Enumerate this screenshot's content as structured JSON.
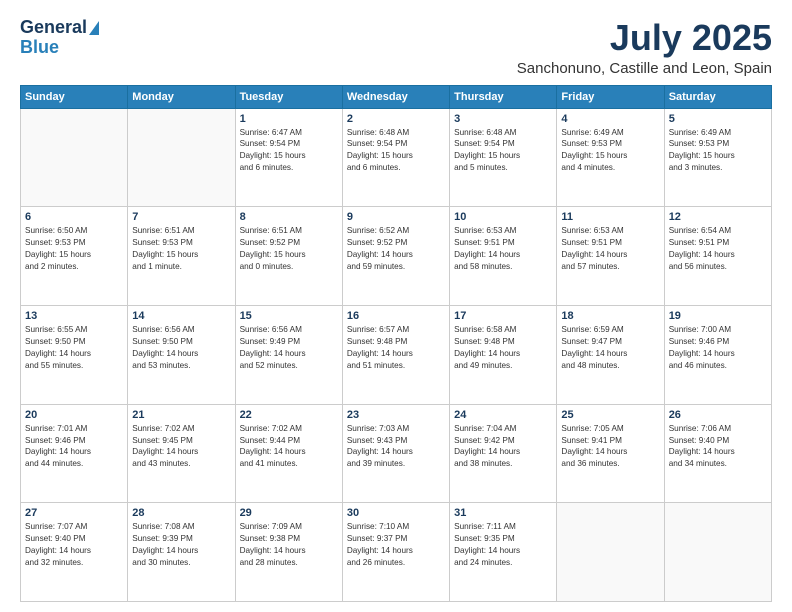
{
  "header": {
    "logo_line1": "General",
    "logo_line2": "Blue",
    "main_title": "July 2025",
    "subtitle": "Sanchonuno, Castille and Leon, Spain"
  },
  "calendar": {
    "headers": [
      "Sunday",
      "Monday",
      "Tuesday",
      "Wednesday",
      "Thursday",
      "Friday",
      "Saturday"
    ],
    "rows": [
      [
        {
          "day": "",
          "info": ""
        },
        {
          "day": "",
          "info": ""
        },
        {
          "day": "1",
          "info": "Sunrise: 6:47 AM\nSunset: 9:54 PM\nDaylight: 15 hours\nand 6 minutes."
        },
        {
          "day": "2",
          "info": "Sunrise: 6:48 AM\nSunset: 9:54 PM\nDaylight: 15 hours\nand 6 minutes."
        },
        {
          "day": "3",
          "info": "Sunrise: 6:48 AM\nSunset: 9:54 PM\nDaylight: 15 hours\nand 5 minutes."
        },
        {
          "day": "4",
          "info": "Sunrise: 6:49 AM\nSunset: 9:53 PM\nDaylight: 15 hours\nand 4 minutes."
        },
        {
          "day": "5",
          "info": "Sunrise: 6:49 AM\nSunset: 9:53 PM\nDaylight: 15 hours\nand 3 minutes."
        }
      ],
      [
        {
          "day": "6",
          "info": "Sunrise: 6:50 AM\nSunset: 9:53 PM\nDaylight: 15 hours\nand 2 minutes."
        },
        {
          "day": "7",
          "info": "Sunrise: 6:51 AM\nSunset: 9:53 PM\nDaylight: 15 hours\nand 1 minute."
        },
        {
          "day": "8",
          "info": "Sunrise: 6:51 AM\nSunset: 9:52 PM\nDaylight: 15 hours\nand 0 minutes."
        },
        {
          "day": "9",
          "info": "Sunrise: 6:52 AM\nSunset: 9:52 PM\nDaylight: 14 hours\nand 59 minutes."
        },
        {
          "day": "10",
          "info": "Sunrise: 6:53 AM\nSunset: 9:51 PM\nDaylight: 14 hours\nand 58 minutes."
        },
        {
          "day": "11",
          "info": "Sunrise: 6:53 AM\nSunset: 9:51 PM\nDaylight: 14 hours\nand 57 minutes."
        },
        {
          "day": "12",
          "info": "Sunrise: 6:54 AM\nSunset: 9:51 PM\nDaylight: 14 hours\nand 56 minutes."
        }
      ],
      [
        {
          "day": "13",
          "info": "Sunrise: 6:55 AM\nSunset: 9:50 PM\nDaylight: 14 hours\nand 55 minutes."
        },
        {
          "day": "14",
          "info": "Sunrise: 6:56 AM\nSunset: 9:50 PM\nDaylight: 14 hours\nand 53 minutes."
        },
        {
          "day": "15",
          "info": "Sunrise: 6:56 AM\nSunset: 9:49 PM\nDaylight: 14 hours\nand 52 minutes."
        },
        {
          "day": "16",
          "info": "Sunrise: 6:57 AM\nSunset: 9:48 PM\nDaylight: 14 hours\nand 51 minutes."
        },
        {
          "day": "17",
          "info": "Sunrise: 6:58 AM\nSunset: 9:48 PM\nDaylight: 14 hours\nand 49 minutes."
        },
        {
          "day": "18",
          "info": "Sunrise: 6:59 AM\nSunset: 9:47 PM\nDaylight: 14 hours\nand 48 minutes."
        },
        {
          "day": "19",
          "info": "Sunrise: 7:00 AM\nSunset: 9:46 PM\nDaylight: 14 hours\nand 46 minutes."
        }
      ],
      [
        {
          "day": "20",
          "info": "Sunrise: 7:01 AM\nSunset: 9:46 PM\nDaylight: 14 hours\nand 44 minutes."
        },
        {
          "day": "21",
          "info": "Sunrise: 7:02 AM\nSunset: 9:45 PM\nDaylight: 14 hours\nand 43 minutes."
        },
        {
          "day": "22",
          "info": "Sunrise: 7:02 AM\nSunset: 9:44 PM\nDaylight: 14 hours\nand 41 minutes."
        },
        {
          "day": "23",
          "info": "Sunrise: 7:03 AM\nSunset: 9:43 PM\nDaylight: 14 hours\nand 39 minutes."
        },
        {
          "day": "24",
          "info": "Sunrise: 7:04 AM\nSunset: 9:42 PM\nDaylight: 14 hours\nand 38 minutes."
        },
        {
          "day": "25",
          "info": "Sunrise: 7:05 AM\nSunset: 9:41 PM\nDaylight: 14 hours\nand 36 minutes."
        },
        {
          "day": "26",
          "info": "Sunrise: 7:06 AM\nSunset: 9:40 PM\nDaylight: 14 hours\nand 34 minutes."
        }
      ],
      [
        {
          "day": "27",
          "info": "Sunrise: 7:07 AM\nSunset: 9:40 PM\nDaylight: 14 hours\nand 32 minutes."
        },
        {
          "day": "28",
          "info": "Sunrise: 7:08 AM\nSunset: 9:39 PM\nDaylight: 14 hours\nand 30 minutes."
        },
        {
          "day": "29",
          "info": "Sunrise: 7:09 AM\nSunset: 9:38 PM\nDaylight: 14 hours\nand 28 minutes."
        },
        {
          "day": "30",
          "info": "Sunrise: 7:10 AM\nSunset: 9:37 PM\nDaylight: 14 hours\nand 26 minutes."
        },
        {
          "day": "31",
          "info": "Sunrise: 7:11 AM\nSunset: 9:35 PM\nDaylight: 14 hours\nand 24 minutes."
        },
        {
          "day": "",
          "info": ""
        },
        {
          "day": "",
          "info": ""
        }
      ]
    ]
  }
}
